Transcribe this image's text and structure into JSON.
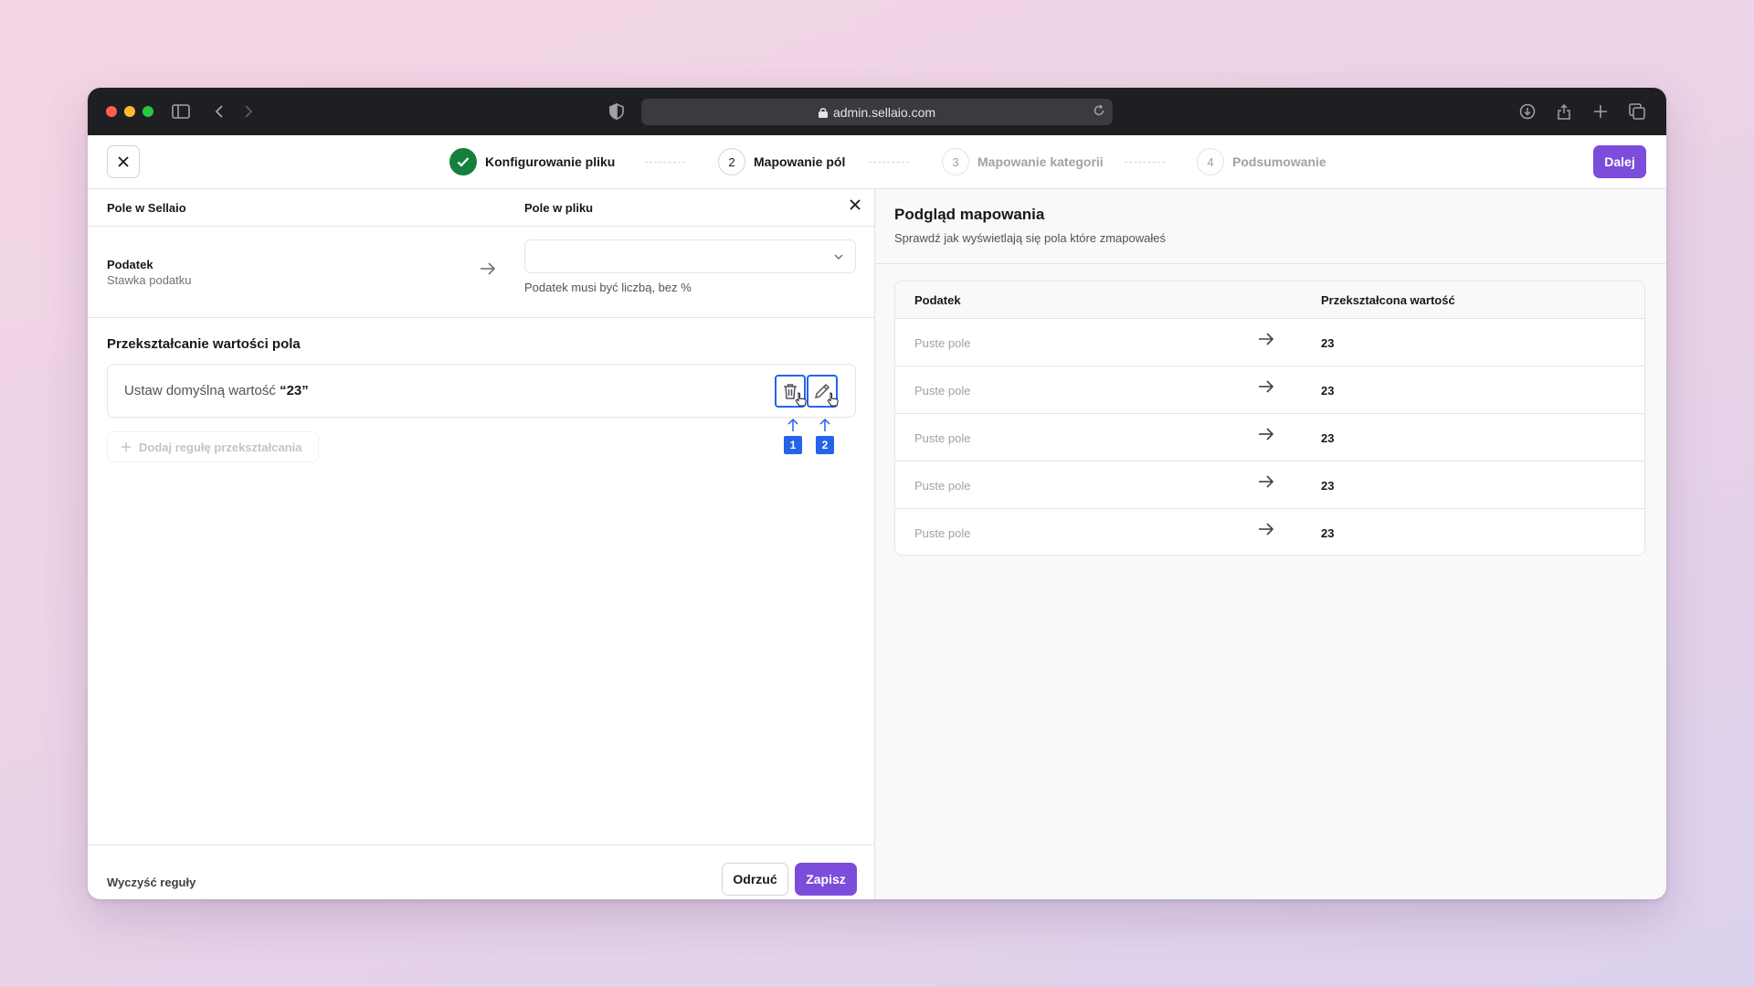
{
  "browser": {
    "url": "admin.sellaio.com",
    "traffic_colors": [
      "#ff5f57",
      "#febc2e",
      "#28c840"
    ]
  },
  "header": {
    "steps": [
      {
        "number": "",
        "label": "Konfigurowanie pliku",
        "state": "done"
      },
      {
        "number": "2",
        "label": "Mapowanie pól",
        "state": "active"
      },
      {
        "number": "3",
        "label": "Mapowanie kategorii",
        "state": "inactive"
      },
      {
        "number": "4",
        "label": "Podsumowanie",
        "state": "inactive"
      }
    ],
    "next_label": "Dalej"
  },
  "mapping": {
    "col_sellaio": "Pole w Sellaio",
    "col_file": "Pole w pliku",
    "field_name": "Podatek",
    "field_sub": "Stawka podatku",
    "hint": "Podatek musi być liczbą, bez %"
  },
  "transform": {
    "title": "Przekształcanie wartości pola",
    "rule_prefix": "Ustaw domyślną wartość ",
    "rule_value": "“23”",
    "markers": [
      "1",
      "2"
    ],
    "add_rule_label": "Dodaj regułę przekształcania"
  },
  "footer": {
    "clear_label": "Wyczyść reguły",
    "discard_label": "Odrzuć",
    "save_label": "Zapisz"
  },
  "preview": {
    "title": "Podgląd mapowania",
    "subtitle": "Sprawdź jak wyświetlają się pola które zmapowałeś",
    "col_source": "Podatek",
    "col_result": "Przekształcona wartość",
    "rows": [
      {
        "source": "Puste pole",
        "result": "23"
      },
      {
        "source": "Puste pole",
        "result": "23"
      },
      {
        "source": "Puste pole",
        "result": "23"
      },
      {
        "source": "Puste pole",
        "result": "23"
      },
      {
        "source": "Puste pole",
        "result": "23"
      }
    ]
  },
  "colors": {
    "accent": "#7c4ddb",
    "success": "#15803d",
    "highlight": "#2563eb"
  }
}
